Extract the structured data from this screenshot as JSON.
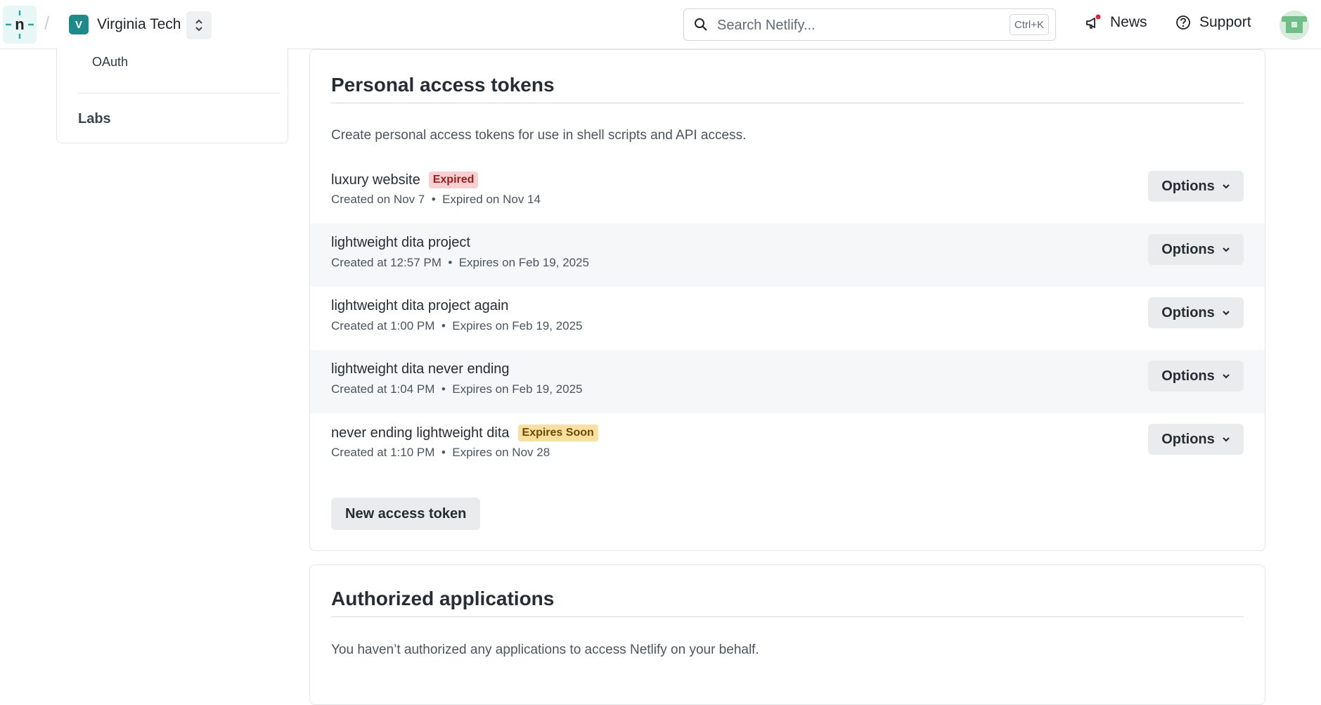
{
  "header": {
    "logo_icon": "netlify-logo-icon",
    "separator": "/",
    "team_initial": "V",
    "team_name": "Virginia Tech",
    "search_placeholder": "Search Netlify...",
    "search_shortcut": "Ctrl+K",
    "news_label": "News",
    "support_label": "Support"
  },
  "sidebar": {
    "sub_item": "OAuth",
    "item": "Labs"
  },
  "tokens_section": {
    "title": "Personal access tokens",
    "description": "Create personal access tokens for use in shell scripts and API access.",
    "new_token_label": "New access token",
    "tokens": [
      {
        "name": "luxury website",
        "badge": "Expired",
        "meta": "Created on Nov 7  •  Expired on Nov 14",
        "options_label": "Options"
      },
      {
        "name": "lightweight dita project",
        "badge": "",
        "meta": "Created at 12:57 PM  •  Expires on Feb 19, 2025",
        "options_label": "Options"
      },
      {
        "name": "lightweight dita project again",
        "badge": "",
        "meta": "Created at 1:00 PM  •  Expires on Feb 19, 2025",
        "options_label": "Options"
      },
      {
        "name": "lightweight dita never ending",
        "badge": "",
        "meta": "Created at 1:04 PM  •  Expires on Feb 19, 2025",
        "options_label": "Options"
      },
      {
        "name": "never ending lightweight dita",
        "badge": "Expires Soon",
        "meta": "Created at 1:10 PM  •  Expires on Nov 28",
        "options_label": "Options"
      }
    ]
  },
  "apps_section": {
    "title": "Authorized applications",
    "description": "You haven’t authorized any applications to access Netlify on your behalf."
  },
  "colors": {
    "team_badge": "#1f8a8a",
    "badge_expired_bg": "#f9d0d0",
    "badge_soon_bg": "#f9e0a0",
    "news_dot": "#e0263a"
  }
}
